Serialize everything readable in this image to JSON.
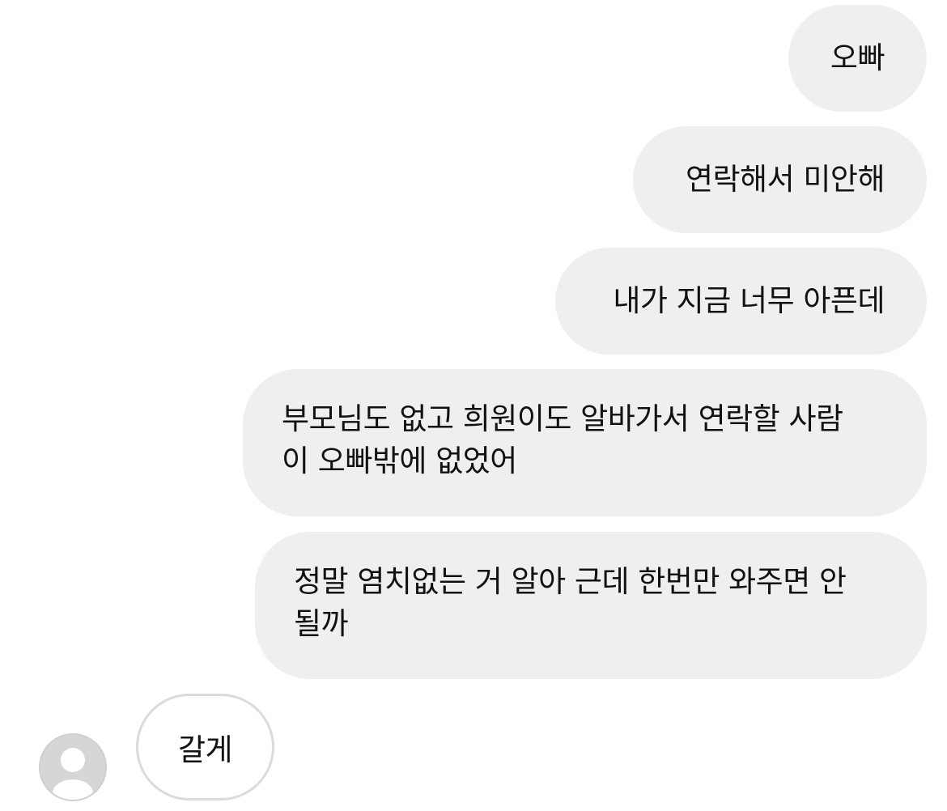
{
  "conversation": {
    "sent_messages": [
      {
        "text": "오빠"
      },
      {
        "text": "연락해서 미안해"
      },
      {
        "text": "내가 지금 너무 아픈데"
      },
      {
        "lines": [
          "부모님도 없고 희원이도 알바가서 연락할 사람",
          "이 오빠밖에 없었어"
        ]
      },
      {
        "lines": [
          "정말 염치없는 거 알아 근데 한번만 와주면 안",
          "될까"
        ]
      }
    ],
    "received_messages": [
      {
        "text": "갈게",
        "avatar_icon": "default-profile-icon"
      }
    ]
  },
  "colors": {
    "sent_bubble": "#efefef",
    "received_bubble_border": "#dbdbdb",
    "avatar_bg": "#d6d6d6",
    "avatar_figure": "#ffffff"
  }
}
